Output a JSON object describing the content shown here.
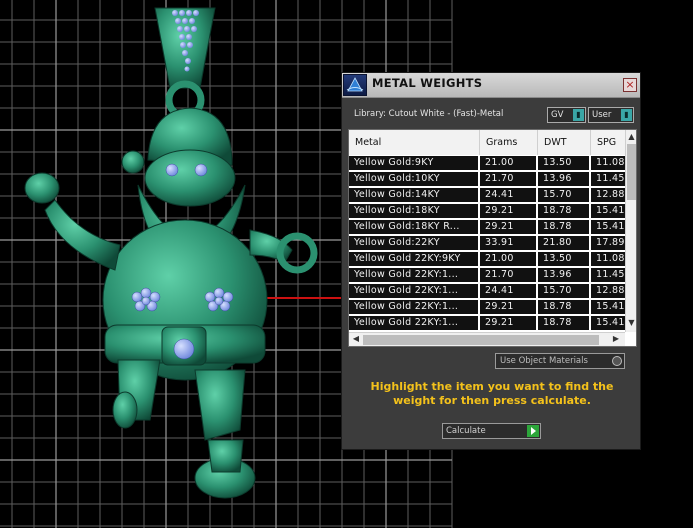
{
  "panel": {
    "title": "METAL WEIGHTS",
    "close_icon": "×",
    "library_label": "Library: Cutout White - (Fast)-Metal",
    "gv_dropdown": "GV",
    "user_dropdown": "User",
    "table": {
      "columns": [
        "Metal",
        "Grams",
        "DWT",
        "SPG"
      ],
      "rows": [
        [
          "Yellow Gold:9KY",
          "21.00",
          "13.50",
          "11.08"
        ],
        [
          "Yellow Gold:10KY",
          "21.70",
          "13.96",
          "11.45"
        ],
        [
          "Yellow Gold:14KY",
          "24.41",
          "15.70",
          "12.88"
        ],
        [
          "Yellow Gold:18KY",
          "29.21",
          "18.78",
          "15.41"
        ],
        [
          "Yellow Gold:18KY R...",
          "29.21",
          "18.78",
          "15.41"
        ],
        [
          "Yellow Gold:22KY",
          "33.91",
          "21.80",
          "17.89"
        ],
        [
          "Yellow Gold 22KY:9KY",
          "21.00",
          "13.50",
          "11.08"
        ],
        [
          "Yellow Gold 22KY:1...",
          "21.70",
          "13.96",
          "11.45"
        ],
        [
          "Yellow Gold 22KY:1...",
          "24.41",
          "15.70",
          "12.88"
        ],
        [
          "Yellow Gold 22KY:1...",
          "29.21",
          "18.78",
          "15.41"
        ],
        [
          "Yellow Gold 22KY:1...",
          "29.21",
          "18.78",
          "15.41"
        ]
      ]
    },
    "use_materials_label": "Use Object Materials",
    "instruction": "Highlight the item you want to find the weight for then press calculate.",
    "calculate_label": "Calculate"
  },
  "colors": {
    "model": "#2e9a74",
    "gems": "#8fa6f0",
    "instruction_text": "#f4c21b",
    "grid": "#6a6a6a",
    "axis_red": "#cc1111"
  },
  "icons": {
    "logo": "app-logo-icon",
    "close": "close-icon",
    "dropdown": "dropdown-arrow-icon",
    "calculate": "play-arrow-icon"
  }
}
